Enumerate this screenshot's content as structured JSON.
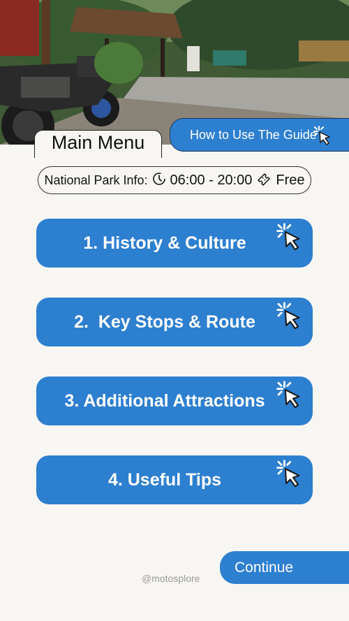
{
  "header": {
    "main_menu_label": "Main Menu",
    "how_to_label": "How to Use The Guide"
  },
  "info": {
    "prefix": "National Park Info:",
    "hours": "06:00 - 20:00",
    "price": "Free",
    "hours_icon": "clock-icon",
    "price_icon": "ticket-icon"
  },
  "menu": [
    {
      "label": "1. History & Culture"
    },
    {
      "label": "2.  Key Stops & Route"
    },
    {
      "label": "3. Additional Attractions"
    },
    {
      "label": "4. Useful Tips"
    }
  ],
  "footer": {
    "continue_label": "Continue",
    "handle": "@motosplore"
  },
  "colors": {
    "accent": "#2d7fd0",
    "background": "#f8f6f2"
  },
  "icons": {
    "button_cursor": "click-cursor-icon"
  }
}
